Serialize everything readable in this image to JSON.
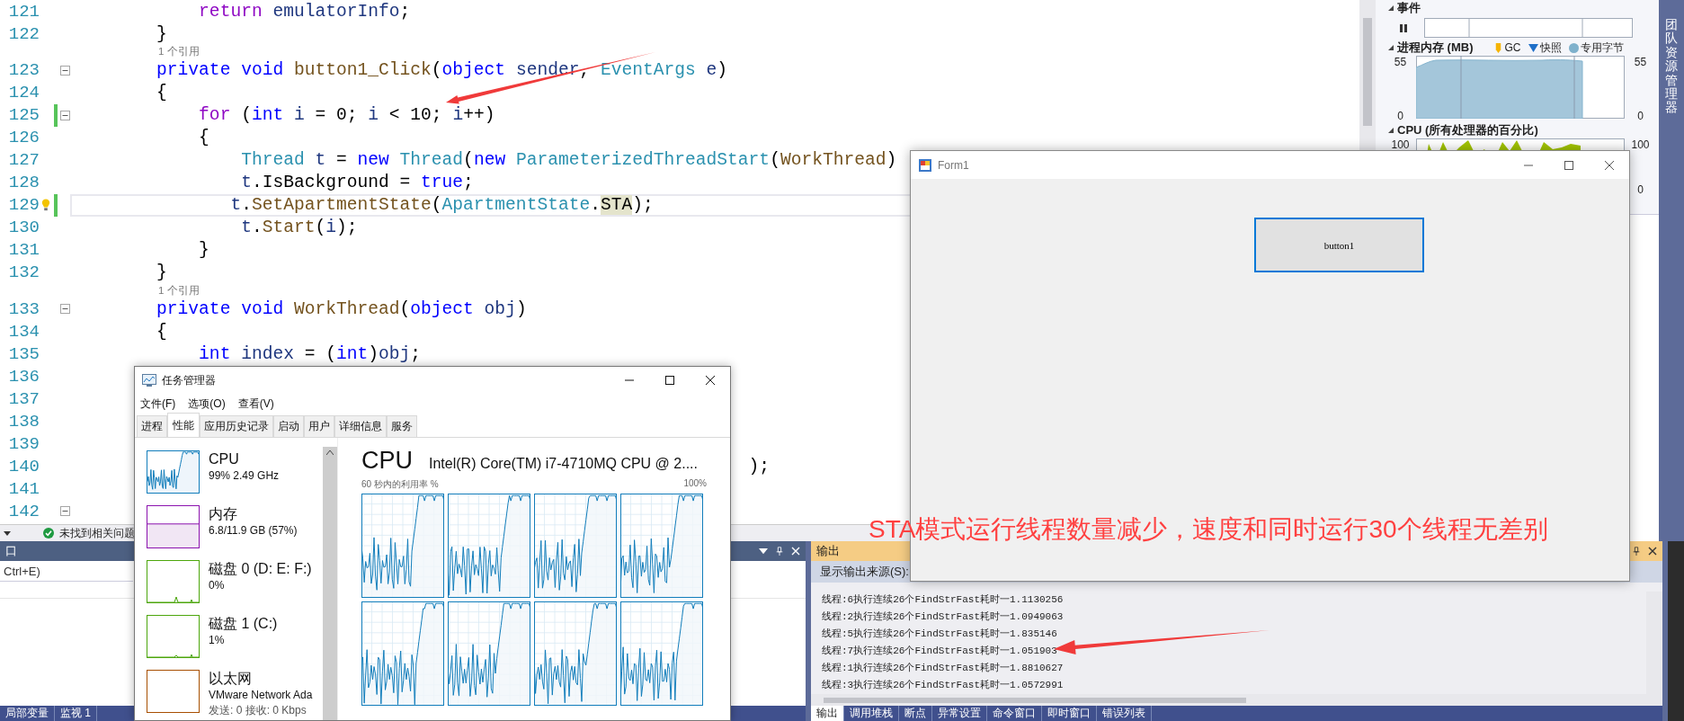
{
  "editor": {
    "lines": [
      {
        "kind": "code",
        "number": "121",
        "fold": false,
        "changed": false,
        "lightbulb": false,
        "current": false,
        "tokens": [
          {
            "kind": "control",
            "text": "            return "
          },
          {
            "kind": "var",
            "text": "emulatorInfo"
          },
          {
            "kind": "plain",
            "text": ";"
          }
        ]
      },
      {
        "kind": "code",
        "number": "122",
        "fold": false,
        "changed": false,
        "lightbulb": false,
        "current": false,
        "tokens": [
          {
            "kind": "plain",
            "text": "        }"
          }
        ]
      },
      {
        "kind": "lens",
        "text": "1 个引用"
      },
      {
        "kind": "code",
        "number": "123",
        "fold": true,
        "changed": false,
        "lightbulb": false,
        "current": false,
        "tokens": [
          {
            "kind": "keyword",
            "text": "        private void "
          },
          {
            "kind": "method",
            "text": "button1_Click"
          },
          {
            "kind": "plain",
            "text": "("
          },
          {
            "kind": "keyword",
            "text": "object "
          },
          {
            "kind": "var",
            "text": "sender"
          },
          {
            "kind": "plain",
            "text": ", "
          },
          {
            "kind": "type",
            "text": "EventArgs "
          },
          {
            "kind": "var",
            "text": "e"
          },
          {
            "kind": "plain",
            "text": ")"
          }
        ]
      },
      {
        "kind": "code",
        "number": "124",
        "fold": false,
        "changed": false,
        "lightbulb": false,
        "current": false,
        "tokens": [
          {
            "kind": "plain",
            "text": "        {"
          }
        ]
      },
      {
        "kind": "code",
        "number": "125",
        "fold": true,
        "changed": true,
        "lightbulb": false,
        "current": false,
        "tokens": [
          {
            "kind": "control",
            "text": "            for"
          },
          {
            "kind": "plain",
            "text": " ("
          },
          {
            "kind": "keyword",
            "text": "int "
          },
          {
            "kind": "var",
            "text": "i"
          },
          {
            "kind": "plain",
            "text": " = 0; "
          },
          {
            "kind": "var",
            "text": "i"
          },
          {
            "kind": "plain",
            "text": " < 10; "
          },
          {
            "kind": "var",
            "text": "i"
          },
          {
            "kind": "plain",
            "text": "++)"
          }
        ]
      },
      {
        "kind": "code",
        "number": "126",
        "fold": false,
        "changed": false,
        "lightbulb": false,
        "current": false,
        "tokens": [
          {
            "kind": "plain",
            "text": "            {"
          }
        ]
      },
      {
        "kind": "code",
        "number": "127",
        "fold": false,
        "changed": false,
        "lightbulb": false,
        "current": false,
        "tokens": [
          {
            "kind": "type",
            "text": "                Thread "
          },
          {
            "kind": "var",
            "text": "t"
          },
          {
            "kind": "plain",
            "text": " = "
          },
          {
            "kind": "keyword",
            "text": "new "
          },
          {
            "kind": "type",
            "text": "Thread"
          },
          {
            "kind": "plain",
            "text": "("
          },
          {
            "kind": "keyword",
            "text": "new "
          },
          {
            "kind": "type",
            "text": "ParameterizedThreadStart"
          },
          {
            "kind": "plain",
            "text": "("
          },
          {
            "kind": "method",
            "text": "WorkThread"
          },
          {
            "kind": "plain",
            "text": ")"
          }
        ]
      },
      {
        "kind": "code",
        "number": "128",
        "fold": false,
        "changed": false,
        "lightbulb": false,
        "current": false,
        "tokens": [
          {
            "kind": "var",
            "text": "                t"
          },
          {
            "kind": "plain",
            "text": ".IsBackground = "
          },
          {
            "kind": "keyword",
            "text": "true"
          },
          {
            "kind": "plain",
            "text": ";"
          }
        ]
      },
      {
        "kind": "code",
        "number": "129",
        "fold": false,
        "changed": true,
        "lightbulb": true,
        "current": true,
        "tokens": [
          {
            "kind": "var",
            "text": "               t"
          },
          {
            "kind": "plain",
            "text": "."
          },
          {
            "kind": "method",
            "text": "SetApartmentState"
          },
          {
            "kind": "plain",
            "text": "("
          },
          {
            "kind": "type",
            "text": "ApartmentState"
          },
          {
            "kind": "plain",
            "text": "."
          },
          {
            "kind": "highlight",
            "text": "STA"
          },
          {
            "kind": "plain",
            "text": ");"
          }
        ]
      },
      {
        "kind": "code",
        "number": "130",
        "fold": false,
        "changed": false,
        "lightbulb": false,
        "current": false,
        "tokens": [
          {
            "kind": "var",
            "text": "                t"
          },
          {
            "kind": "plain",
            "text": "."
          },
          {
            "kind": "method",
            "text": "Start"
          },
          {
            "kind": "plain",
            "text": "("
          },
          {
            "kind": "var",
            "text": "i"
          },
          {
            "kind": "plain",
            "text": ");"
          }
        ]
      },
      {
        "kind": "code",
        "number": "131",
        "fold": false,
        "changed": false,
        "lightbulb": false,
        "current": false,
        "tokens": [
          {
            "kind": "plain",
            "text": "            }"
          }
        ]
      },
      {
        "kind": "code",
        "number": "132",
        "fold": false,
        "changed": false,
        "lightbulb": false,
        "current": false,
        "tokens": [
          {
            "kind": "plain",
            "text": "        }"
          }
        ]
      },
      {
        "kind": "lens",
        "text": "1 个引用"
      },
      {
        "kind": "code",
        "number": "133",
        "fold": true,
        "changed": false,
        "lightbulb": false,
        "current": false,
        "tokens": [
          {
            "kind": "keyword",
            "text": "        private void "
          },
          {
            "kind": "method",
            "text": "WorkThread"
          },
          {
            "kind": "plain",
            "text": "("
          },
          {
            "kind": "keyword",
            "text": "object "
          },
          {
            "kind": "var",
            "text": "obj"
          },
          {
            "kind": "plain",
            "text": ")"
          }
        ]
      },
      {
        "kind": "code",
        "number": "134",
        "fold": false,
        "changed": false,
        "lightbulb": false,
        "current": false,
        "tokens": [
          {
            "kind": "plain",
            "text": "        {"
          }
        ]
      },
      {
        "kind": "code",
        "number": "135",
        "fold": false,
        "changed": false,
        "lightbulb": false,
        "current": false,
        "tokens": [
          {
            "kind": "keyword",
            "text": "            int "
          },
          {
            "kind": "var",
            "text": "index"
          },
          {
            "kind": "plain",
            "text": " = ("
          },
          {
            "kind": "keyword",
            "text": "int"
          },
          {
            "kind": "plain",
            "text": ")"
          },
          {
            "kind": "var",
            "text": "obj"
          },
          {
            "kind": "plain",
            "text": ";"
          }
        ]
      },
      {
        "kind": "code",
        "number": "136",
        "fold": false,
        "changed": false,
        "lightbulb": false,
        "current": false
      },
      {
        "kind": "code",
        "number": "137",
        "fold": false,
        "changed": false,
        "lightbulb": false,
        "current": false
      },
      {
        "kind": "code",
        "number": "138",
        "fold": false,
        "changed": false,
        "lightbulb": false,
        "current": false
      },
      {
        "kind": "code",
        "number": "139",
        "fold": false,
        "changed": false,
        "lightbulb": false,
        "current": false
      },
      {
        "kind": "code",
        "number": "140",
        "fold": false,
        "changed": false,
        "lightbulb": false,
        "current": false,
        "tokens": [
          {
            "kind": "plain",
            "text": "                                                                );"
          }
        ]
      },
      {
        "kind": "code",
        "number": "141",
        "fold": false,
        "changed": false,
        "lightbulb": false,
        "current": false
      },
      {
        "kind": "code",
        "number": "142",
        "fold": true,
        "changed": false,
        "lightbulb": false,
        "current": false
      }
    ],
    "status": "未找到相关问题"
  },
  "diagnostics": {
    "events_label": "事件",
    "memory_label": "进程内存 (MB)",
    "legend": [
      {
        "kind": "tag",
        "label": "GC",
        "color": "#f5b400"
      },
      {
        "kind": "triangle",
        "label": "快照",
        "color": "#1e6fc8"
      },
      {
        "kind": "dot",
        "label": "专用字节",
        "color": "#7fb1cc"
      }
    ],
    "memory_axis": {
      "left_max": "55",
      "left_min": "0",
      "right_max": "55",
      "right_min": "0"
    },
    "cpu_label": "CPU (所有处理器的百分比)",
    "cpu_axis": {
      "left_max": "100",
      "right_max": "100",
      "right_min": "0"
    }
  },
  "side_tab": "团队资源管理器",
  "locals_panel": {
    "title": "口",
    "search_placeholder": "Ctrl+E)",
    "tabs": [
      {
        "label": "局部变量",
        "selected": false
      },
      {
        "label": "监视 1",
        "selected": false
      }
    ]
  },
  "output": {
    "title": "输出",
    "source_label": "显示输出来源(S):",
    "lines": [
      "线程:6执行连续26个FindStrFast耗时一1.1130256",
      "线程:2执行连续26个FindStrFast耗时一1.0949063",
      "线程:5执行连续26个FindStrFast耗时一1.835146",
      "线程:7执行连续26个FindStrFast耗时一1.051903",
      "线程:1执行连续26个FindStrFast耗时一1.8810627",
      "线程:3执行连续26个FindStrFast耗时一1.0572991"
    ],
    "tabs": [
      {
        "label": "输出",
        "selected": true
      },
      {
        "label": "调用堆栈",
        "selected": false
      },
      {
        "label": "断点",
        "selected": false
      },
      {
        "label": "异常设置",
        "selected": false
      },
      {
        "label": "命令窗口",
        "selected": false
      },
      {
        "label": "即时窗口",
        "selected": false
      },
      {
        "label": "错误列表",
        "selected": false
      }
    ]
  },
  "task_manager": {
    "title": "任务管理器",
    "menu": [
      "文件(F)",
      "选项(O)",
      "查看(V)"
    ],
    "tabs": [
      {
        "label": "进程",
        "selected": false
      },
      {
        "label": "性能",
        "selected": true
      },
      {
        "label": "应用历史记录",
        "selected": false
      },
      {
        "label": "启动",
        "selected": false
      },
      {
        "label": "用户",
        "selected": false
      },
      {
        "label": "详细信息",
        "selected": false
      },
      {
        "label": "服务",
        "selected": false
      }
    ],
    "resources": [
      {
        "kind": "cpu",
        "name": "CPU",
        "details": [
          "99% 2.49 GHz"
        ],
        "color": "#117dbb"
      },
      {
        "kind": "memory",
        "name": "内存",
        "details": [
          "6.8/11.9 GB (57%)"
        ],
        "color": "#8b12ae"
      },
      {
        "kind": "disk",
        "name": "磁盘 0 (D: E: F:)",
        "details": [
          "0%"
        ],
        "color": "#4da60c"
      },
      {
        "kind": "disk",
        "name": "磁盘 1 (C:)",
        "details": [
          "1%"
        ],
        "color": "#4da60c"
      },
      {
        "kind": "network",
        "name": "以太网",
        "details": [
          "VMware Network Ada",
          "发送: 0 接收: 0 Kbps"
        ],
        "color": "#a74f01"
      }
    ],
    "heading": "CPU",
    "model": "Intel(R) Core(TM) i7-4710MQ CPU @ 2....",
    "graph_caption": "60 秒内的利用率 %",
    "graph_max": "100%"
  },
  "form": {
    "title": "Form1",
    "button": "button1"
  },
  "annotation": "STA模式运行线程数量减少，速度和同时运行30个线程无差别"
}
